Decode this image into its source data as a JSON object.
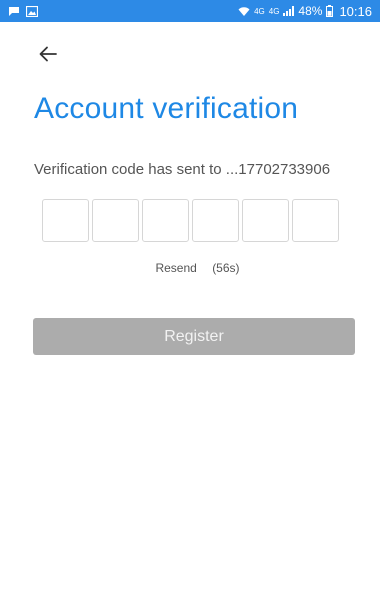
{
  "status_bar": {
    "network_label": "4G",
    "network_label_2": "4G",
    "battery": "48%",
    "time": "10:16",
    "background_color": "#2d8ae6",
    "left_icons": [
      "message-icon",
      "image-icon"
    ],
    "right_icons": [
      "wifi-icon",
      "signal-icon",
      "battery-icon"
    ]
  },
  "header": {
    "back_icon": "arrow-left-icon",
    "title": "Account verification",
    "title_color": "#1e88e5"
  },
  "verification": {
    "message": "Verification code has sent to ...17702733906",
    "code_length": 6,
    "code_values": [
      "",
      "",
      "",
      "",
      "",
      ""
    ],
    "resend_label": "Resend",
    "countdown": "(56s)"
  },
  "actions": {
    "register_label": "Register",
    "register_enabled": false,
    "register_color": "#acacac"
  }
}
